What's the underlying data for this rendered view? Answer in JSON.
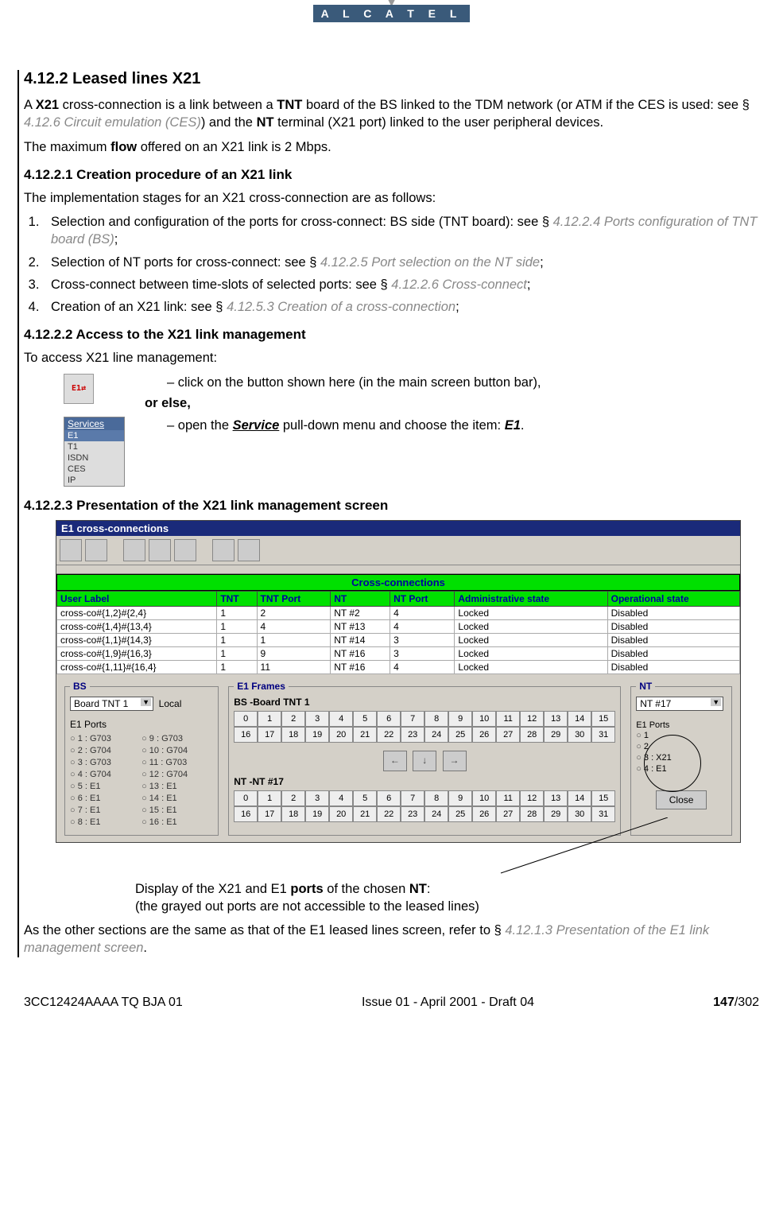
{
  "brand": "A L C A T E L",
  "section_4_12_2": {
    "title": "4.12.2   Leased lines X21",
    "para1_a": "A ",
    "para1_b": "X21",
    "para1_c": " cross-connection is a link between a ",
    "para1_d": "TNT",
    "para1_e": " board of the BS linked to the TDM network (or ATM if the CES is used: see § ",
    "para1_ref": "4.12.6 Circuit emulation (CES)",
    "para1_f": ") and the ",
    "para1_g": "NT",
    "para1_h": " terminal (X21 port) linked to the user peripheral devices.",
    "para2_a": "The maximum ",
    "para2_b": "flow",
    "para2_c": " offered on an X21 link is 2 Mbps."
  },
  "section_4_12_2_1": {
    "title": "4.12.2.1  Creation procedure of an X21 link",
    "intro": "The implementation stages for an X21 cross-connection are as follows:",
    "steps": [
      {
        "text": "Selection and configuration of the ports for cross-connect: BS side (TNT board): see § ",
        "ref": "4.12.2.4 Ports configuration of TNT board (BS)",
        "tail": ";"
      },
      {
        "text": "Selection of NT ports for cross-connect: see § ",
        "ref": "4.12.2.5 Port selection on the NT side",
        "tail": ";"
      },
      {
        "text": "Cross-connect between time-slots of selected ports: see § ",
        "ref": "4.12.2.6 Cross-connect",
        "tail": ";"
      },
      {
        "text": "Creation of an X21 link: see § ",
        "ref": "4.12.5.3 Creation of a cross-connection",
        "tail": ";"
      }
    ]
  },
  "section_4_12_2_2": {
    "title": "4.12.2.2  Access to the X21 link management",
    "intro": "To access X21 line management:",
    "line1": "click on the button shown here (in the main screen button bar),",
    "or_else": "or else,",
    "line2_a": "open the ",
    "line2_b": "Service",
    "line2_c": " pull-down menu and choose the item: ",
    "line2_d": "E1",
    "line2_e": ".",
    "menu": {
      "header": "Services",
      "items": [
        "E1",
        "T1",
        "ISDN",
        "CES",
        "IP"
      ],
      "hl": 0
    }
  },
  "section_4_12_2_3": {
    "title": "4.12.2.3  Presentation of the X21 link management screen"
  },
  "screenshot": {
    "title": "E1 cross-connections",
    "cc_header": "Cross-connections",
    "columns": [
      "User Label",
      "TNT",
      "TNT Port",
      "NT",
      "NT Port",
      "Administrative state",
      "Operational state"
    ],
    "rows": [
      [
        "cross-co#{1,2}#{2,4}",
        "1",
        "2",
        "NT #2",
        "4",
        "Locked",
        "Disabled"
      ],
      [
        "cross-co#{1,4}#{13,4}",
        "1",
        "4",
        "NT #13",
        "4",
        "Locked",
        "Disabled"
      ],
      [
        "cross-co#{1,1}#{14,3}",
        "1",
        "1",
        "NT #14",
        "3",
        "Locked",
        "Disabled"
      ],
      [
        "cross-co#{1,9}#{16,3}",
        "1",
        "9",
        "NT #16",
        "3",
        "Locked",
        "Disabled"
      ],
      [
        "cross-co#{1,11}#{16,4}",
        "1",
        "11",
        "NT #16",
        "4",
        "Locked",
        "Disabled"
      ]
    ],
    "bs": {
      "legend": "BS",
      "select": "Board TNT 1",
      "local": "Local",
      "ports_label": "E1 Ports",
      "ports_left": [
        "1 : G703",
        "2 : G704",
        "3 : G703",
        "4 : G704",
        "5 : E1",
        "6 : E1",
        "7 : E1",
        "8 : E1"
      ],
      "ports_right": [
        "9 : G703",
        "10 : G704",
        "11 : G703",
        "12 : G704",
        "13 : E1",
        "14 : E1",
        "15 : E1",
        "16 : E1"
      ]
    },
    "e1": {
      "legend": "E1 Frames",
      "bs_label": "BS -Board TNT 1",
      "nt_label": "NT -NT #17",
      "slots_row1": [
        "0",
        "1",
        "2",
        "3",
        "4",
        "5",
        "6",
        "7",
        "8",
        "9",
        "10",
        "11",
        "12",
        "13",
        "14",
        "15"
      ],
      "slots_row2": [
        "16",
        "17",
        "18",
        "19",
        "20",
        "21",
        "22",
        "23",
        "24",
        "25",
        "26",
        "27",
        "28",
        "29",
        "30",
        "31"
      ],
      "arrows": [
        "←",
        "↓",
        "→"
      ]
    },
    "nt": {
      "legend": "NT",
      "select": "NT #17",
      "ports_label": "E1 Ports",
      "ports": [
        "1",
        "2",
        "3 : X21",
        "4 : E1"
      ],
      "close": "Close"
    }
  },
  "caption": {
    "line1_a": "Display of the X21 and E1 ",
    "line1_b": "ports",
    "line1_c": " of the chosen ",
    "line1_d": "NT",
    "line1_e": ":",
    "line2": "(the grayed out ports are not accessible to the leased lines)"
  },
  "closing": {
    "a": "As the other sections are the same as that of the E1 leased lines screen, refer to § ",
    "ref": "4.12.1.3 Presentation of the E1 link management screen",
    "b": "."
  },
  "footer": {
    "left": "3CC12424AAAA TQ BJA 01",
    "center": "Issue 01 - April 2001 - Draft 04",
    "right_bold": "147",
    "right_rest": "/302"
  }
}
